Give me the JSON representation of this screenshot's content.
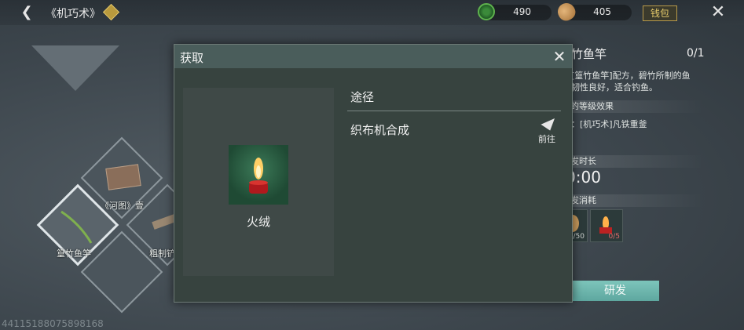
{
  "topbar": {
    "back_icon": "back-arrow-icon",
    "title": "《机巧术》",
    "jade_value": "490",
    "seed_value": "405",
    "wallet_label": "钱包",
    "close_icon": "close-icon"
  },
  "grid": {
    "cells": [
      {
        "label": "《河图》壹"
      },
      {
        "label": "篁竹鱼竿"
      },
      {
        "label": "粗制铲"
      }
    ]
  },
  "detail": {
    "title": "竹鱼竿",
    "count": "0/1",
    "desc": "[篁竹鱼竿]配方，碧竹所制的鱼\n韧性良好，适合钓鱼。",
    "level_section": "的等级效果",
    "level_text": "：[机巧术]凡铁重釜",
    "time_section": "发时长",
    "time_value": "0:00",
    "cost_section": "发消耗",
    "cost_slots": [
      "/50",
      "0/5"
    ],
    "research_label": "研发"
  },
  "modal": {
    "title": "获取",
    "item_name": "火绒",
    "route_header": "途径",
    "routes": [
      {
        "name": "织布机合成",
        "action_label": "前往"
      }
    ]
  },
  "footer": {
    "uid": "44115188075898168"
  }
}
